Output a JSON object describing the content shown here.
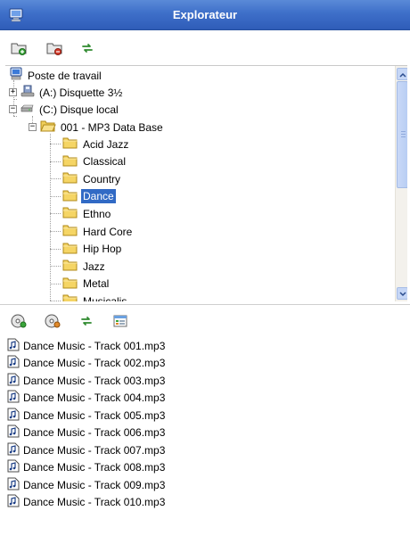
{
  "window": {
    "title": "Explorateur",
    "icon": "explorer-window-icon"
  },
  "top_toolbar": {
    "buttons": [
      {
        "icon": "new-folder-icon"
      },
      {
        "icon": "delete-folder-icon"
      },
      {
        "icon": "refresh-icon"
      }
    ]
  },
  "tree": {
    "root": {
      "label": "Poste de travail",
      "icon": "computer-icon"
    },
    "drives": [
      {
        "label": "(A:) Disquette 3½",
        "icon": "floppy-drive-icon",
        "expander": "+"
      },
      {
        "label": "(C:) Disque local",
        "icon": "hard-drive-icon",
        "expander": "−"
      }
    ],
    "database_folder": {
      "label": "001 - MP3 Data Base",
      "expander": "−"
    },
    "genres": [
      {
        "label": "Acid Jazz"
      },
      {
        "label": "Classical"
      },
      {
        "label": "Country"
      },
      {
        "label": "Dance"
      },
      {
        "label": "Ethno"
      },
      {
        "label": "Hard Core"
      },
      {
        "label": "Hip Hop"
      },
      {
        "label": "Jazz"
      },
      {
        "label": "Metal"
      },
      {
        "label": "Musicalis"
      }
    ],
    "selected": "Dance"
  },
  "bottom_toolbar": {
    "buttons": [
      {
        "icon": "cd-icon"
      },
      {
        "icon": "cd-remove-icon"
      },
      {
        "icon": "refresh-icon"
      },
      {
        "icon": "view-details-icon"
      }
    ]
  },
  "files": [
    {
      "name": "Dance Music - Track 001.mp3"
    },
    {
      "name": "Dance Music - Track 002.mp3"
    },
    {
      "name": "Dance Music - Track 003.mp3"
    },
    {
      "name": "Dance Music - Track 004.mp3"
    },
    {
      "name": "Dance Music - Track 005.mp3"
    },
    {
      "name": "Dance Music - Track 006.mp3"
    },
    {
      "name": "Dance Music - Track 007.mp3"
    },
    {
      "name": "Dance Music - Track 008.mp3"
    },
    {
      "name": "Dance Music - Track 009.mp3"
    },
    {
      "name": "Dance Music - Track 010.mp3"
    }
  ],
  "colors": {
    "title_bar": "#3e6fc9",
    "selection": "#316ac5",
    "folder": "#f5d565",
    "scrollbar": "#c5d6f6"
  }
}
